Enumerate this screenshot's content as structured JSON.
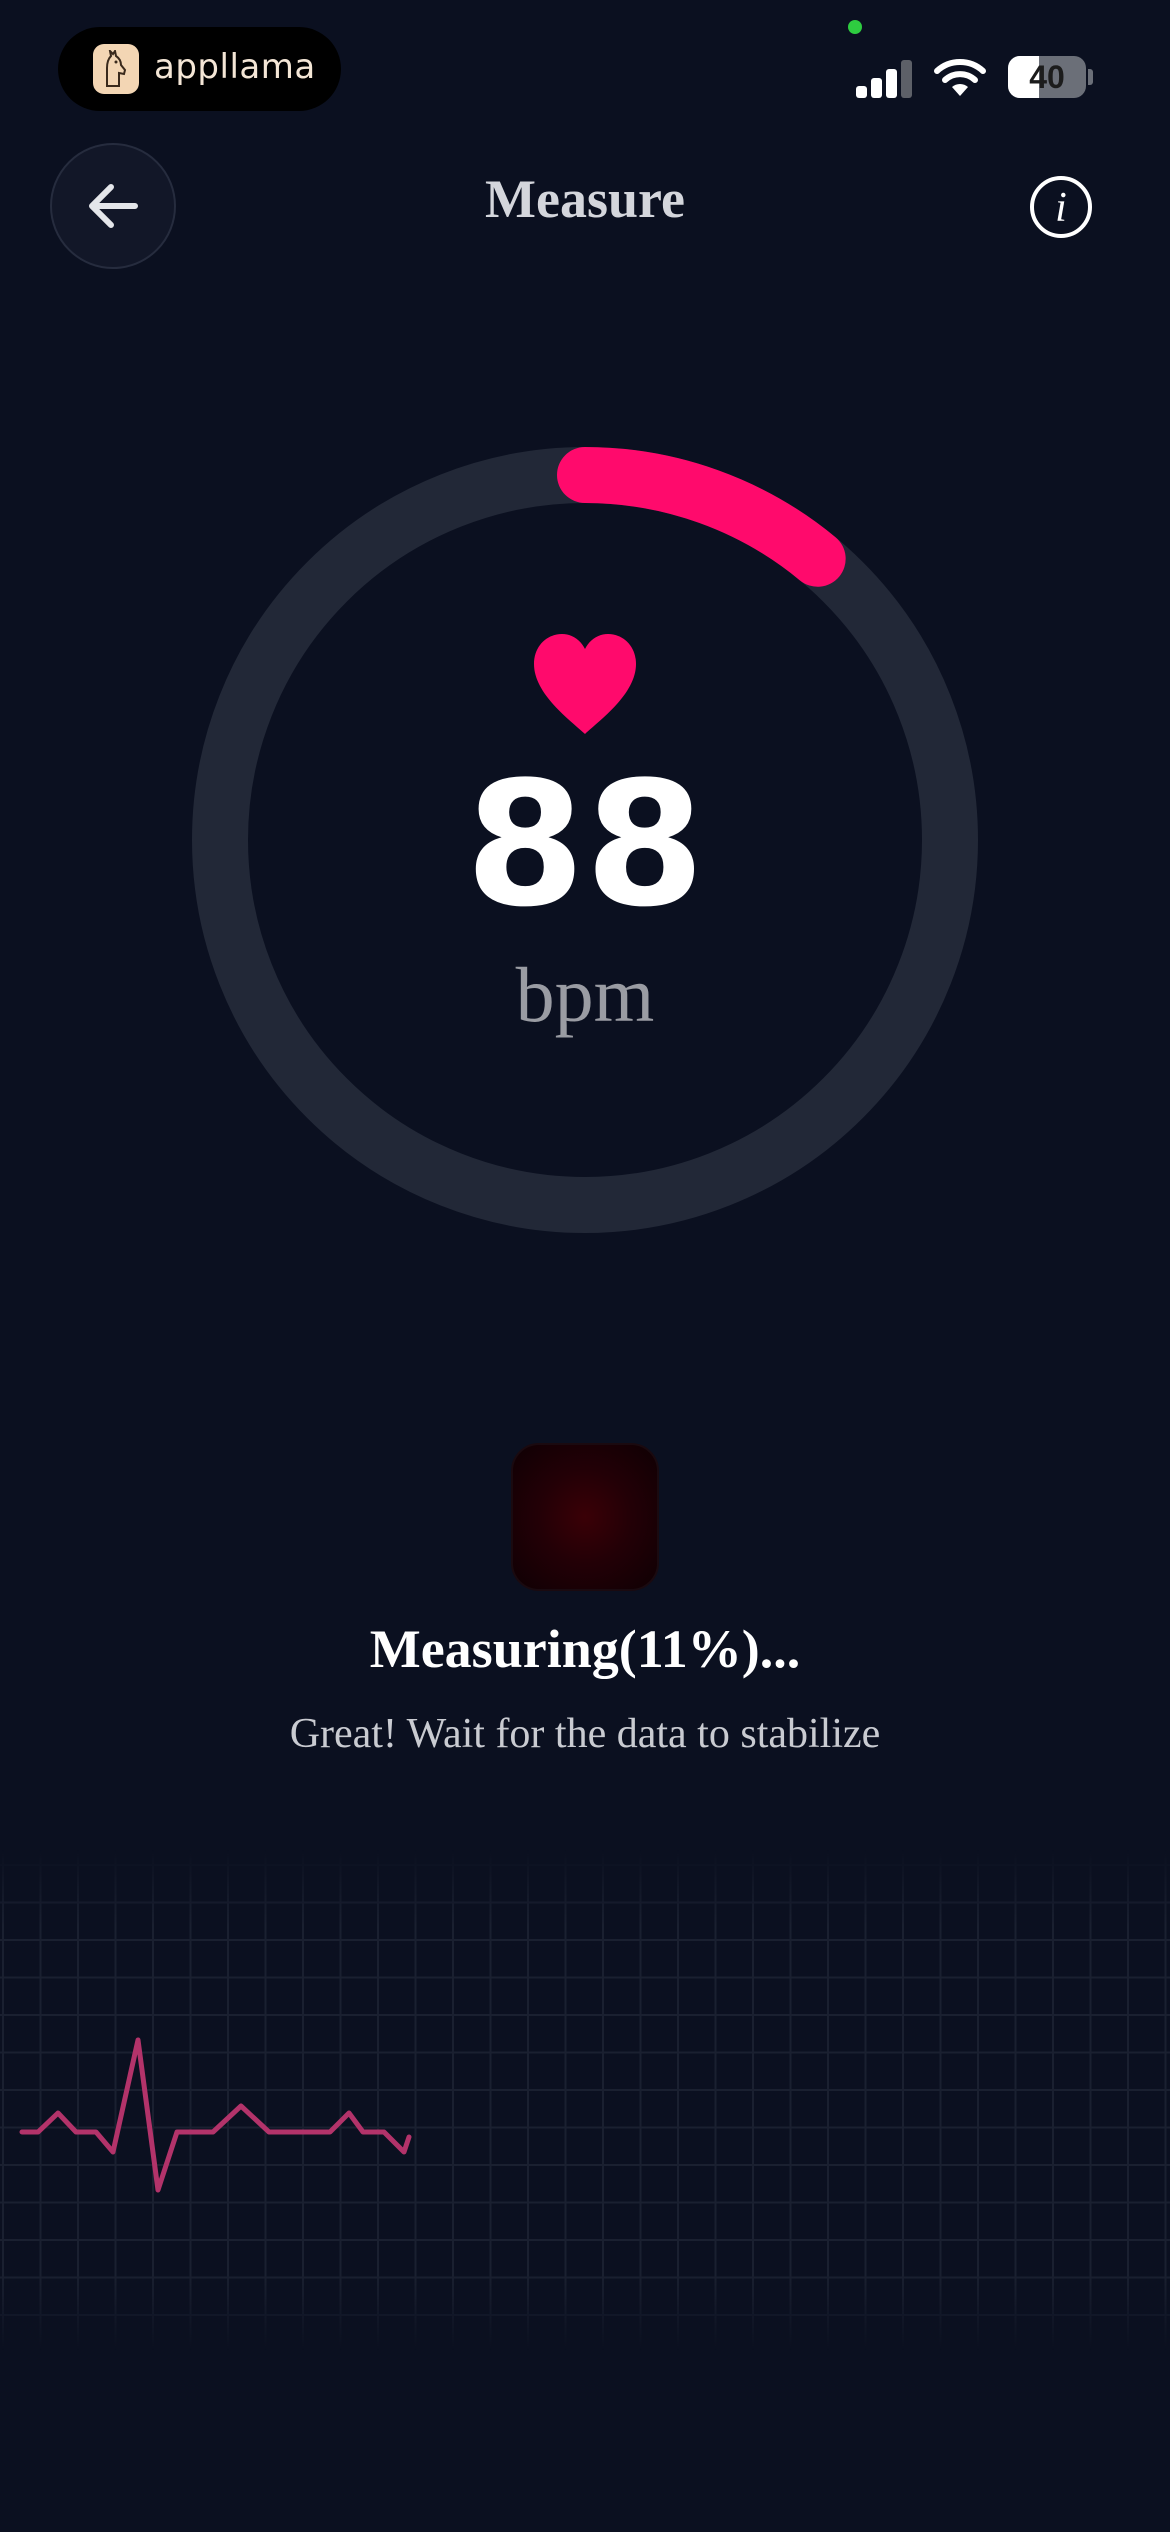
{
  "status_bar": {
    "app_name": "appllama",
    "battery": "40",
    "battery_level": 0.4,
    "cellular_bars": 3,
    "icons": [
      "app-logo-icon",
      "cellular-signal-icon",
      "wifi-icon",
      "battery-icon"
    ]
  },
  "header": {
    "title": "Measure",
    "info_glyph": "i",
    "icons": [
      "back-arrow-icon",
      "info-icon"
    ]
  },
  "measurement": {
    "bpm": "88",
    "unit": "bpm",
    "progress": 0.11,
    "status_title": "Measuring(11%)...",
    "status_subtitle": "Great! Wait for the data to stabilize"
  },
  "colors": {
    "background": "#0b1020",
    "accent": "#ff0a6c",
    "ring_track": "#222837",
    "ecg_line": "#b3336a",
    "grid": "#1a2030"
  }
}
